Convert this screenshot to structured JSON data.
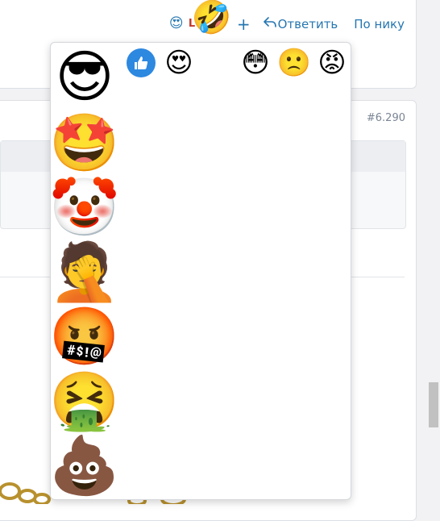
{
  "post_actions": {
    "summary_reaction_emoji": "😍",
    "summary_label": "L",
    "hover_emoji": "🤣",
    "add_reaction": "+",
    "reply_icon": "reply-arrow-icon",
    "reply_label": "Ответить",
    "by_nick_label": "По нику"
  },
  "post_meta": {
    "number": "#6.290"
  },
  "reaction_picker": {
    "top_row": [
      {
        "name": "like",
        "emoji": "👍"
      },
      {
        "name": "heart-eyes",
        "emoji": "😍"
      },
      {
        "name": "flushed",
        "emoji": "😳"
      },
      {
        "name": "confused",
        "emoji": "🙁"
      },
      {
        "name": "angry",
        "emoji": "😡"
      }
    ],
    "big_column": [
      {
        "name": "sunglasses",
        "emoji": "😎"
      },
      {
        "name": "star-struck",
        "emoji": "🤩"
      },
      {
        "name": "clown",
        "emoji": "🤡"
      },
      {
        "name": "facepalm",
        "emoji": "🤦"
      },
      {
        "name": "cursing",
        "emoji": "🤬"
      },
      {
        "name": "vomiting",
        "emoji": "🤮"
      },
      {
        "name": "poop",
        "emoji": "💩"
      }
    ]
  },
  "colors": {
    "link": "#2577b1",
    "like_badge": "#2d88e0"
  }
}
